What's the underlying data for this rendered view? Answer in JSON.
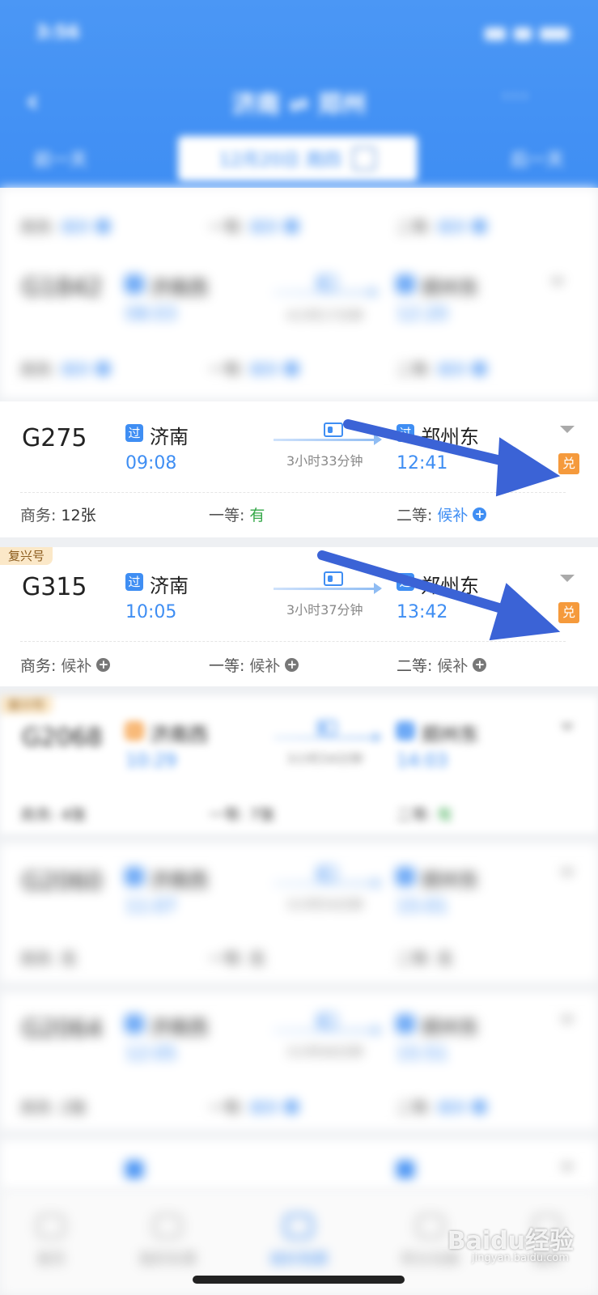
{
  "status_bar": {
    "time": "3:56"
  },
  "header": {
    "back_icon": "back-arrow-icon",
    "route": "济南 ⇌ 郑州",
    "more": "···",
    "prev_day": "前一天",
    "next_day": "后一天",
    "date": "12月20日 周四"
  },
  "trains": [
    {
      "id": "G1842",
      "dep_tag": "过",
      "dep_station": "济南西",
      "dep_time": "08:03",
      "arr_tag": "过",
      "arr_station": "郑州东",
      "arr_time": "12:20",
      "duration": "4小时17分钟",
      "seats": [
        {
          "label": "商务:",
          "value": "候补"
        },
        {
          "label": "一等:",
          "value": "候补"
        },
        {
          "label": "二等:",
          "value": "候补"
        }
      ]
    },
    {
      "id": "G275",
      "tag": "",
      "dep_tag": "过",
      "dep_station": "济南",
      "dep_time": "09:08",
      "arr_tag": "过",
      "arr_station": "郑州东",
      "arr_time": "12:41",
      "duration": "3小时33分钟",
      "exchange_badge": "兑",
      "seats": [
        {
          "label": "商务:",
          "value": "12张"
        },
        {
          "label": "一等:",
          "value": "有"
        },
        {
          "label": "二等:",
          "value": "候补"
        }
      ]
    },
    {
      "id": "G315",
      "tag": "复兴号",
      "dep_tag": "过",
      "dep_station": "济南",
      "dep_time": "10:05",
      "arr_tag": "过",
      "arr_station": "郑州东",
      "arr_time": "13:42",
      "duration": "3小时37分钟",
      "exchange_badge": "兑",
      "seats": [
        {
          "label": "商务:",
          "value": "候补"
        },
        {
          "label": "一等:",
          "value": "候补"
        },
        {
          "label": "二等:",
          "value": "候补"
        }
      ]
    },
    {
      "id": "G2068",
      "tag": "复兴号",
      "dep_tag": "始",
      "dep_station": "济南西",
      "dep_time": "10:29",
      "arr_tag": "过",
      "arr_station": "郑州东",
      "arr_time": "14:03",
      "duration": "3小时34分钟",
      "seats": [
        {
          "label": "商务:",
          "value": "4张"
        },
        {
          "label": "一等:",
          "value": "7张"
        },
        {
          "label": "二等:",
          "value": "有"
        }
      ]
    },
    {
      "id": "G2060",
      "dep_tag": "过",
      "dep_station": "济南西",
      "dep_time": "11:07",
      "arr_tag": "过",
      "arr_station": "郑州东",
      "arr_time": "15:01",
      "duration": "3小时54分钟",
      "seats": [
        {
          "label": "商务:",
          "value": "无"
        },
        {
          "label": "一等:",
          "value": "无"
        },
        {
          "label": "二等:",
          "value": "无"
        }
      ]
    },
    {
      "id": "G2064",
      "dep_tag": "过",
      "dep_station": "济南西",
      "dep_time": "12:05",
      "arr_tag": "过",
      "arr_station": "郑州东",
      "arr_time": "15:51",
      "duration": "3小时46分钟",
      "seats": [
        {
          "label": "商务:",
          "value": "2张"
        },
        {
          "label": "一等:",
          "value": "候补"
        },
        {
          "label": "二等:",
          "value": "候补"
        }
      ]
    }
  ],
  "bottom_tabs": [
    {
      "label": "首页"
    },
    {
      "label": "我的车票"
    },
    {
      "label": "候补购票"
    },
    {
      "label": "积分兑换"
    },
    {
      "label": "我的"
    }
  ],
  "watermark": {
    "brand": "Baidu经验",
    "url": "jingyan.baidu.com"
  },
  "colors": {
    "header": "#3f8ef3",
    "accent": "#3f8ef3",
    "badge": "#f59a3c",
    "available": "#36a84a"
  }
}
